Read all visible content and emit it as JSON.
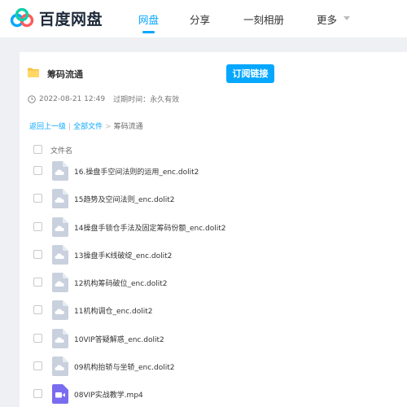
{
  "brand": {
    "name": "百度网盘",
    "logo_icon": "cloud-logo-icon",
    "accent": "#06a7ff"
  },
  "nav": {
    "items": [
      {
        "label": "网盘",
        "active": true
      },
      {
        "label": "分享",
        "active": false
      },
      {
        "label": "一刻相册",
        "active": false
      },
      {
        "label": "更多",
        "active": false
      }
    ]
  },
  "share": {
    "title": "筹码流通",
    "subscribe_label": "订阅链接",
    "time": "2022-08-21 12:49",
    "expire_label": "过期时间：",
    "expire_value": "永久有效"
  },
  "breadcrumb": {
    "back": "返回上一级",
    "all_files": "全部文件",
    "current": "筹码流通"
  },
  "file_list": {
    "column_header": "文件名",
    "files": [
      {
        "name": "16.操盘手空间法则的运用_enc.dolit2",
        "icon": "file-icon"
      },
      {
        "name": "15趋势及空间法则_enc.dolit2",
        "icon": "file-icon"
      },
      {
        "name": "14操盘手锁仓手法及固定筹码份额_enc.dolit2",
        "icon": "file-icon"
      },
      {
        "name": "13操盘手K线破绽_enc.dolit2",
        "icon": "file-icon"
      },
      {
        "name": "12机构筹码破位_enc.dolit2",
        "icon": "file-icon"
      },
      {
        "name": "11机构调仓_enc.dolit2",
        "icon": "file-icon"
      },
      {
        "name": "10VIP答疑解惑_enc.dolit2",
        "icon": "file-icon"
      },
      {
        "name": "09机构抬轿与坐轿_enc.dolit2",
        "icon": "file-icon"
      },
      {
        "name": "08VIP实战教学.mp4",
        "icon": "video-icon"
      }
    ]
  }
}
